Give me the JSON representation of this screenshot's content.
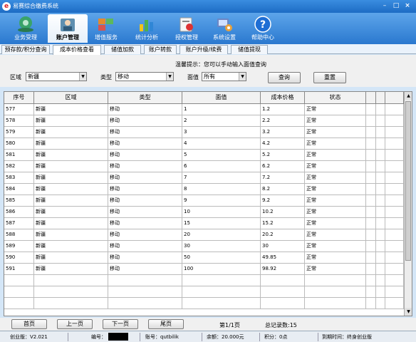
{
  "window": {
    "logo_char": "e",
    "title": "易赛综合缴费系统",
    "min_glyph": "–",
    "max_glyph": "□",
    "close_glyph": "×"
  },
  "toolbar": {
    "items": [
      {
        "label": "业务受理",
        "icon": "business-accept-icon",
        "color": "#2e8b57"
      },
      {
        "label": "账户管理",
        "icon": "account-manage-icon",
        "color": "#4a7a9c",
        "active": true
      },
      {
        "label": "增值服务",
        "icon": "value-added-icon",
        "color": "#d9702a"
      },
      {
        "label": "统计分析",
        "icon": "statistics-icon",
        "color": "#3b9b3b"
      },
      {
        "label": "授权管理",
        "icon": "authorization-icon",
        "color": "#c43c3c"
      },
      {
        "label": "系统设置",
        "icon": "system-settings-icon",
        "color": "#5a6fa8"
      },
      {
        "label": "帮助中心",
        "icon": "help-icon",
        "color": "#2a6fd0"
      }
    ]
  },
  "subtabs": [
    {
      "label": "预存款/积分查询"
    },
    {
      "label": "成本价格查看",
      "active": true
    },
    {
      "label": "储值加款"
    },
    {
      "label": "账户转款"
    },
    {
      "label": "账户升级/续费"
    },
    {
      "label": "储值提现"
    }
  ],
  "filters": {
    "hint": "温馨提示：您可以手动输入面值查询",
    "region_label": "区域",
    "region_value": "新疆",
    "type_label": "类型",
    "type_value": "移动",
    "face_label": "面值",
    "face_value": "所有",
    "query_button": "查询",
    "reset_button": "重置"
  },
  "table": {
    "headers": [
      "序号",
      "区域",
      "类型",
      "面值",
      "成本价格",
      "状态"
    ],
    "rows": [
      [
        "577",
        "新疆",
        "移动",
        "1",
        "1.2",
        "正常"
      ],
      [
        "578",
        "新疆",
        "移动",
        "2",
        "2.2",
        "正常"
      ],
      [
        "579",
        "新疆",
        "移动",
        "3",
        "3.2",
        "正常"
      ],
      [
        "580",
        "新疆",
        "移动",
        "4",
        "4.2",
        "正常"
      ],
      [
        "581",
        "新疆",
        "移动",
        "5",
        "5.2",
        "正常"
      ],
      [
        "582",
        "新疆",
        "移动",
        "6",
        "6.2",
        "正常"
      ],
      [
        "583",
        "新疆",
        "移动",
        "7",
        "7.2",
        "正常"
      ],
      [
        "584",
        "新疆",
        "移动",
        "8",
        "8.2",
        "正常"
      ],
      [
        "585",
        "新疆",
        "移动",
        "9",
        "9.2",
        "正常"
      ],
      [
        "586",
        "新疆",
        "移动",
        "10",
        "10.2",
        "正常"
      ],
      [
        "587",
        "新疆",
        "移动",
        "15",
        "15.2",
        "正常"
      ],
      [
        "588",
        "新疆",
        "移动",
        "20",
        "20.2",
        "正常"
      ],
      [
        "589",
        "新疆",
        "移动",
        "30",
        "30",
        "正常"
      ],
      [
        "590",
        "新疆",
        "移动",
        "50",
        "49.85",
        "正常"
      ],
      [
        "591",
        "新疆",
        "移动",
        "100",
        "98.92",
        "正常"
      ]
    ],
    "empty_rows": 3
  },
  "pager": {
    "first": "首页",
    "prev": "上一页",
    "next": "下一页",
    "last": "尾页",
    "page_info": "第1/1页",
    "total_info": "总记录数:15"
  },
  "statusbar": {
    "edition": "创业版：V2.021",
    "id_label": "编号：",
    "account": "账号：qutbilik",
    "balance": "余额：20.000元",
    "points": "积分：0点",
    "expiry": "到期时间：终身创业版"
  }
}
